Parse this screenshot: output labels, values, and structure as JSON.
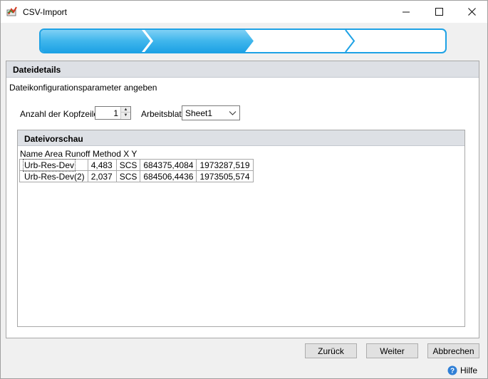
{
  "window": {
    "title": "CSV-Import",
    "minimize": "—",
    "maximize": "☐",
    "close": "✕"
  },
  "wizard": {
    "steps_total": 4,
    "steps_completed": 2,
    "active_color": "#1ea2e5",
    "light_color": "#5ec3f0"
  },
  "details": {
    "header": "Dateidetails",
    "description": "Dateikonfigurationsparameter angeben",
    "header_rows_label": "Anzahl der Kopfzeilen",
    "header_rows_value": "1",
    "worksheet_label": "Arbeitsblatt",
    "worksheet_value": "Sheet1"
  },
  "preview": {
    "header": "Dateivorschau",
    "columns_line": "Name Area Runoff Method X Y",
    "rows": [
      [
        "Urb-Res-Dev",
        "4,483",
        "SCS",
        "684375,4084",
        "1973287,519"
      ],
      [
        "Urb-Res-Dev(2)",
        "2,037",
        "SCS",
        "684506,4436",
        "1973505,574"
      ]
    ]
  },
  "buttons": {
    "back": "Zurück",
    "next": "Weiter",
    "cancel": "Abbrechen",
    "help": "Hilfe"
  }
}
